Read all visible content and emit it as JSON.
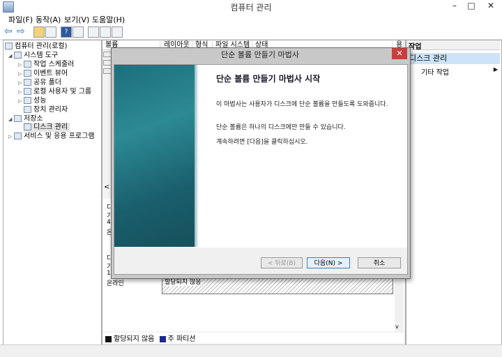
{
  "window": {
    "title": "컴퓨터 관리",
    "minimize": "–",
    "maximize": "□",
    "close": "✕"
  },
  "menu": [
    "파일(F)",
    "동작(A)",
    "보기(V)",
    "도움말(H)"
  ],
  "tree": {
    "root": "컴퓨터 관리(로컬)",
    "system_tools": "시스템 도구",
    "task_scheduler": "작업 스케줄러",
    "event_viewer": "이벤트 뷰어",
    "shared_folders": "공유 폴더",
    "local_users": "로컬 사용자 및 그룹",
    "performance": "성능",
    "device_manager": "장치 관리자",
    "storage": "저장소",
    "disk_management": "디스크 관리",
    "services": "서비스 및 응용 프로그램"
  },
  "columns": [
    "볼륨",
    "레이아웃",
    "형식",
    "파일 시스템",
    "상태",
    "용"
  ],
  "disk_map": {
    "unallocated_label": "할당되지 않음",
    "row_labels": [
      "디",
      "기",
      "4",
      "온",
      "디",
      "기",
      "1",
      "온라인"
    ],
    "scroll_left": "<",
    "scroll_up": "^",
    "scroll_down": "v"
  },
  "legend": {
    "unallocated": "할당되지 않음",
    "primary": "주 파티션"
  },
  "actions": {
    "header": "작업",
    "selected": "디스크 관리",
    "more": "기타 작업",
    "more_arrow": "▶"
  },
  "dialog": {
    "title": "단순 볼륨 만들기 마법사",
    "close": "✕",
    "heading": "단순 볼륨 만들기 마법사 시작",
    "paragraphs": [
      "이 마법사는 사용자가 디스크에 단순 볼륨을 만들도록 도와줍니다.",
      "단순 볼륨은 하나의 디스크에만 만들 수 있습니다.",
      "계속하려면 [다음]을 클릭하십시오."
    ],
    "back": "< 뒤로(B)",
    "next": "다음(N) >",
    "cancel": "취소"
  },
  "colors": {
    "banner": "#1d6f7c",
    "selection": "#cde3f7",
    "close": "#c74040"
  }
}
